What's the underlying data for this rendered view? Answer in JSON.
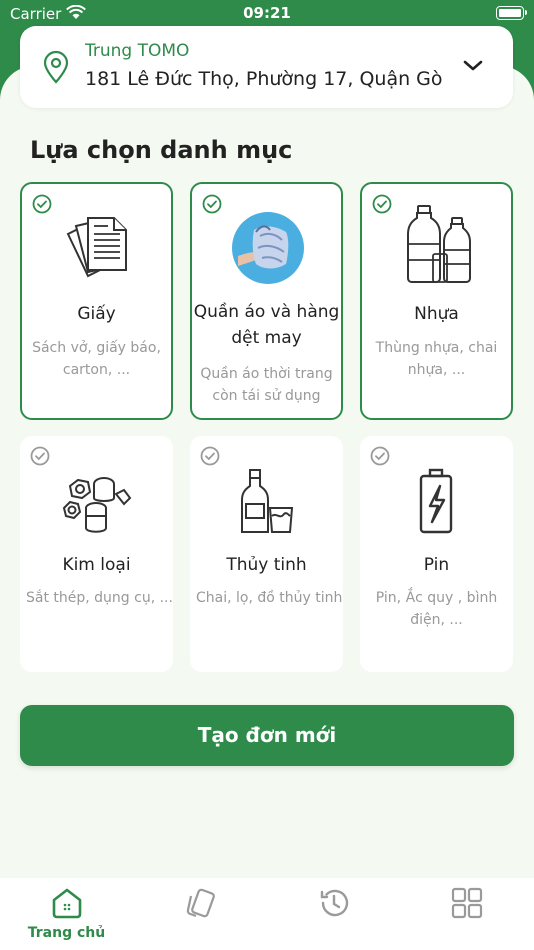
{
  "status_bar": {
    "carrier": "Carrier",
    "time": "09:21"
  },
  "location": {
    "name": "Trung TOMO",
    "address": "181 Lê Đức Thọ, Phường 17, Quận Gò Vấp"
  },
  "section_title": "Lựa chọn danh mục",
  "categories": [
    {
      "title": "Giấy",
      "description": "Sách vở, giấy báo, carton, ...",
      "selected": true,
      "icon": "paper-icon"
    },
    {
      "title": "Quần áo và hàng dệt may",
      "description": "Quần áo thời trang còn tái sử dụng",
      "selected": true,
      "icon": "clothes-photo-icon"
    },
    {
      "title": "Nhựa",
      "description": "Thùng nhựa, chai nhựa, ...",
      "selected": true,
      "icon": "plastic-bottles-icon"
    },
    {
      "title": "Kim loại",
      "description": "Sắt thép, dụng cụ, ...",
      "selected": false,
      "icon": "metal-icon"
    },
    {
      "title": "Thủy tinh",
      "description": "Chai, lọ, đồ thủy tinh",
      "selected": false,
      "icon": "glass-bottle-icon"
    },
    {
      "title": "Pin",
      "description": "Pin, Ắc quy , bình điện, ...",
      "selected": false,
      "icon": "battery-icon"
    }
  ],
  "cta_label": "Tạo đơn mới",
  "tabs": [
    {
      "label": "Trang chủ",
      "icon": "home-icon",
      "active": true
    },
    {
      "label": "",
      "icon": "cards-icon",
      "active": false
    },
    {
      "label": "",
      "icon": "history-icon",
      "active": false
    },
    {
      "label": "",
      "icon": "grid-icon",
      "active": false
    }
  ],
  "colors": {
    "primary": "#2e8b4a",
    "background": "#f4faf1",
    "muted_icon": "#9a9a9a"
  }
}
